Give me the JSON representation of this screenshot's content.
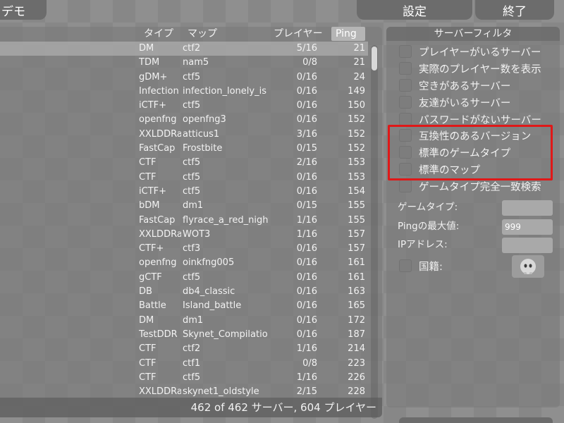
{
  "tabs": {
    "demo": "デモ",
    "settings": "設定",
    "quit": "終了"
  },
  "list": {
    "headers": {
      "type": "タイプ",
      "map": "マップ",
      "players": "プレイヤー",
      "ping": "Ping"
    },
    "rows": [
      {
        "type": "DM",
        "map": "ctf2",
        "players": "5/16",
        "ping": "21"
      },
      {
        "type": "TDM",
        "map": "nam5",
        "players": "0/8",
        "ping": "21"
      },
      {
        "type": "gDM+",
        "map": "ctf5",
        "players": "0/16",
        "ping": "24"
      },
      {
        "type": "Infection",
        "map": "infection_lonely_is",
        "players": "0/16",
        "ping": "149"
      },
      {
        "type": "iCTF+",
        "map": "ctf5",
        "players": "0/16",
        "ping": "150"
      },
      {
        "type": "openfng",
        "map": "openfng3",
        "players": "0/16",
        "ping": "152"
      },
      {
        "type": "XXLDDRa",
        "map": "atticus1",
        "players": "3/16",
        "ping": "152"
      },
      {
        "type": "FastCap",
        "map": "Frostbite",
        "players": "0/15",
        "ping": "152"
      },
      {
        "type": "CTF",
        "map": "ctf5",
        "players": "2/16",
        "ping": "153"
      },
      {
        "type": "CTF",
        "map": "ctf5",
        "players": "0/16",
        "ping": "153"
      },
      {
        "type": "iCTF+",
        "map": "ctf5",
        "players": "0/16",
        "ping": "154"
      },
      {
        "type": "bDM",
        "map": "dm1",
        "players": "0/15",
        "ping": "155"
      },
      {
        "type": "FastCap",
        "map": "flyrace_a_red_night",
        "players": "1/16",
        "ping": "155"
      },
      {
        "type": "XXLDDRa",
        "map": "WOT3",
        "players": "1/16",
        "ping": "157"
      },
      {
        "type": "CTF+",
        "map": "ctf3",
        "players": "0/16",
        "ping": "157"
      },
      {
        "type": "openfng",
        "map": "oinkfng005",
        "players": "0/16",
        "ping": "161"
      },
      {
        "type": "gCTF",
        "map": "ctf5",
        "players": "0/16",
        "ping": "161"
      },
      {
        "type": "DB",
        "map": "db4_classic",
        "players": "0/16",
        "ping": "163"
      },
      {
        "type": "Battle",
        "map": "Island_battle",
        "players": "0/16",
        "ping": "165"
      },
      {
        "type": "DM",
        "map": "dm1",
        "players": "0/16",
        "ping": "172"
      },
      {
        "type": "TestDDR",
        "map": "Skynet_Compilatio",
        "players": "0/16",
        "ping": "187"
      },
      {
        "type": "CTF",
        "map": "ctf2",
        "players": "1/16",
        "ping": "214"
      },
      {
        "type": "CTF",
        "map": "ctf1",
        "players": "0/8",
        "ping": "223"
      },
      {
        "type": "CTF",
        "map": "ctf5",
        "players": "1/16",
        "ping": "226"
      },
      {
        "type": "XXLDDRa",
        "map": "skynet1_oldstyle",
        "players": "2/15",
        "ping": "228"
      }
    ],
    "footer": "462 of 462 サーバー, 604 プレイヤー"
  },
  "filter": {
    "title": "サーバーフィルタ",
    "options": [
      "プレイヤーがいるサーバー",
      "実際のプレイヤー数を表示",
      "空きがあるサーバー",
      "友達がいるサーバー",
      "パスワードがないサーバー",
      "互換性のあるバージョン",
      "標準のゲームタイプ",
      "標準のマップ",
      "ゲームタイプ完全一致検索"
    ],
    "gametype_label": "ゲームタイプ:",
    "gametype_value": "",
    "maxping_label": "Pingの最大値:",
    "maxping_value": "999",
    "ip_label": "IPアドレス:",
    "ip_value": "",
    "country_label": "国籍:",
    "flag_icon": "default-flag-icon"
  },
  "colors": {
    "highlight": "#e01818"
  }
}
